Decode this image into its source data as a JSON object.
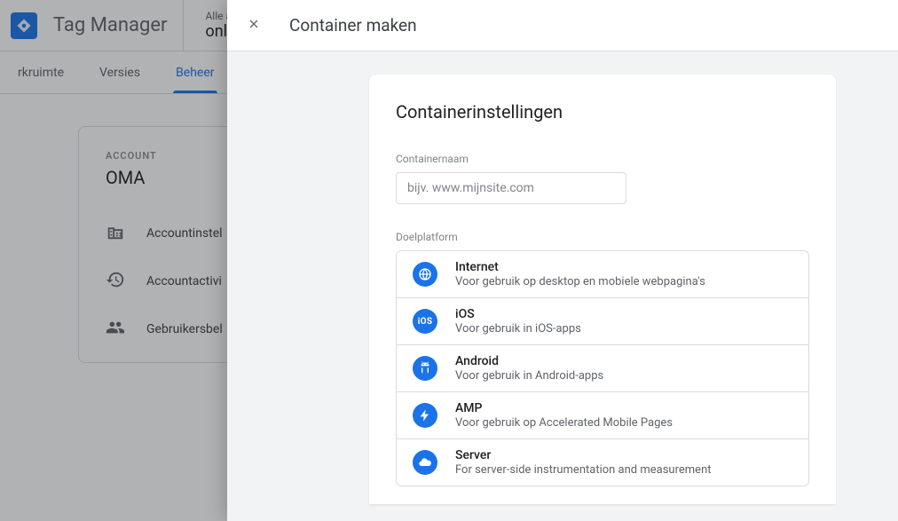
{
  "header": {
    "brand": "Tag Manager",
    "accounts_label": "Alle ac",
    "container_name": "onli"
  },
  "tabs": {
    "workspace": "rkruimte",
    "versions": "Versies",
    "admin": "Beheer"
  },
  "panel": {
    "label": "ACCOUNT",
    "title": "OMA",
    "items": [
      {
        "label": "Accountinstel"
      },
      {
        "label": "Accountactivi"
      },
      {
        "label": "Gebruikersbel"
      }
    ]
  },
  "modal": {
    "title": "Container maken",
    "card_title": "Containerinstellingen",
    "name_label": "Containernaam",
    "name_placeholder": "bijv. www.mijnsite.com",
    "platform_label": "Doelplatform",
    "options": [
      {
        "title": "Internet",
        "desc": "Voor gebruik op desktop en mobiele webpagina's"
      },
      {
        "title": "iOS",
        "desc": "Voor gebruik in iOS-apps"
      },
      {
        "title": "Android",
        "desc": "Voor gebruik in Android-apps"
      },
      {
        "title": "AMP",
        "desc": "Voor gebruik op Accelerated Mobile Pages"
      },
      {
        "title": "Server",
        "desc": "For server-side instrumentation and measurement"
      }
    ]
  }
}
